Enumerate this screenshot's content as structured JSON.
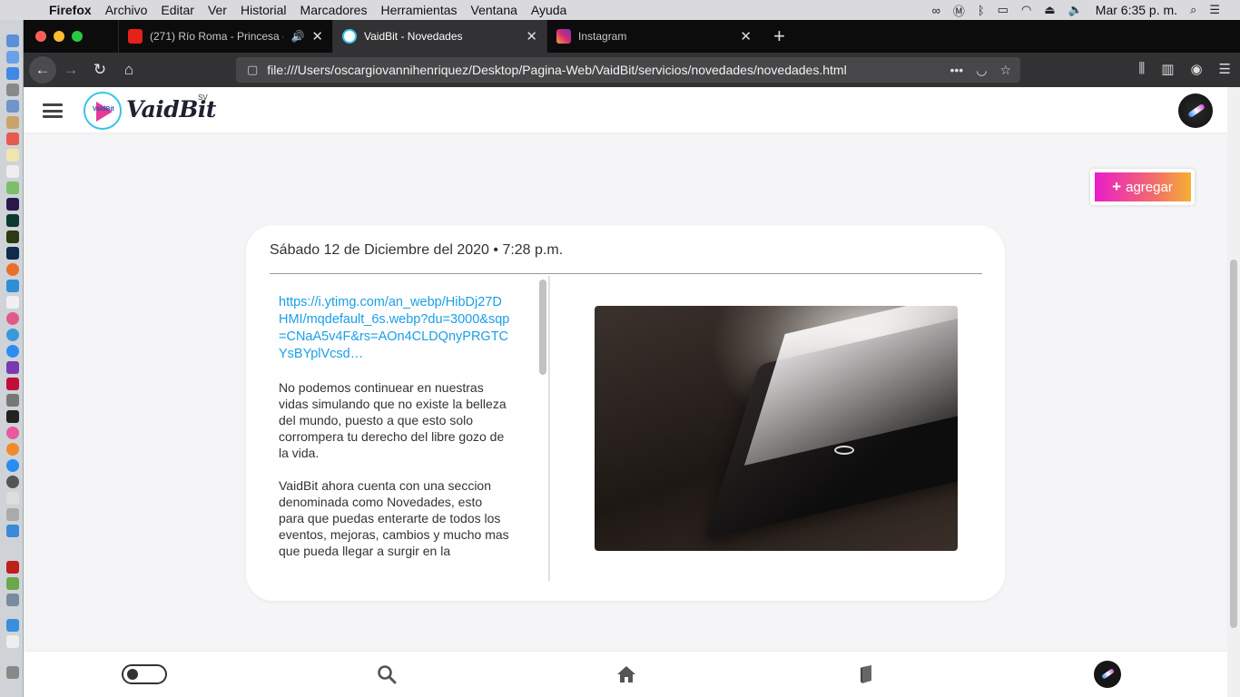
{
  "menubar": {
    "app": "Firefox",
    "items": [
      "Archivo",
      "Editar",
      "Ver",
      "Historial",
      "Marcadores",
      "Herramientas",
      "Ventana",
      "Ayuda"
    ],
    "clock": "Mar 6:35 p. m."
  },
  "tabs": [
    {
      "label": "(271) Río Roma - Princesa (",
      "active": false,
      "favicon": "youtube-icon",
      "audio": true
    },
    {
      "label": "VaidBit - Novedades",
      "active": true,
      "favicon": "vaidbit-icon",
      "audio": false
    },
    {
      "label": "Instagram",
      "active": false,
      "favicon": "instagram-icon",
      "audio": false
    }
  ],
  "url": "file:///Users/oscargiovannihenriquez/Desktop/Pagina-Web/VaidBit/servicios/novedades/novedades.html",
  "site": {
    "logo_text": "VaidBit",
    "logo_mini": "VaidBit",
    "logo_sup": "SV",
    "add_button": "agregar"
  },
  "post": {
    "date": "Sábado 12 de Diciembre del 2020 • 7:28 p.m.",
    "link": "https://i.ytimg.com/an_webp/HibDj27DHMI/mqdefault_6s.webp?du=3000&sqp=CNaA5v4F&rs=AOn4CLDQnyPRGTCYsBYplVcsd…",
    "paragraphs": [
      "No podemos continuear en nuestras vidas simulando que no existe la belleza del mundo, puesto a que esto solo corrompera tu derecho del libre gozo de la vida.",
      "VaidBit ahora cuenta con una seccion denominada como Novedades, esto para que puedas enterarte de todos los eventos, mejoras, cambios y mucho mas que pueda llegar a surgir en la"
    ]
  },
  "colors": {
    "link": "#1a9ee8",
    "add_gradient_start": "#e91ec9",
    "add_gradient_end": "#f6b033",
    "logo_ring": "#39c5e8"
  }
}
